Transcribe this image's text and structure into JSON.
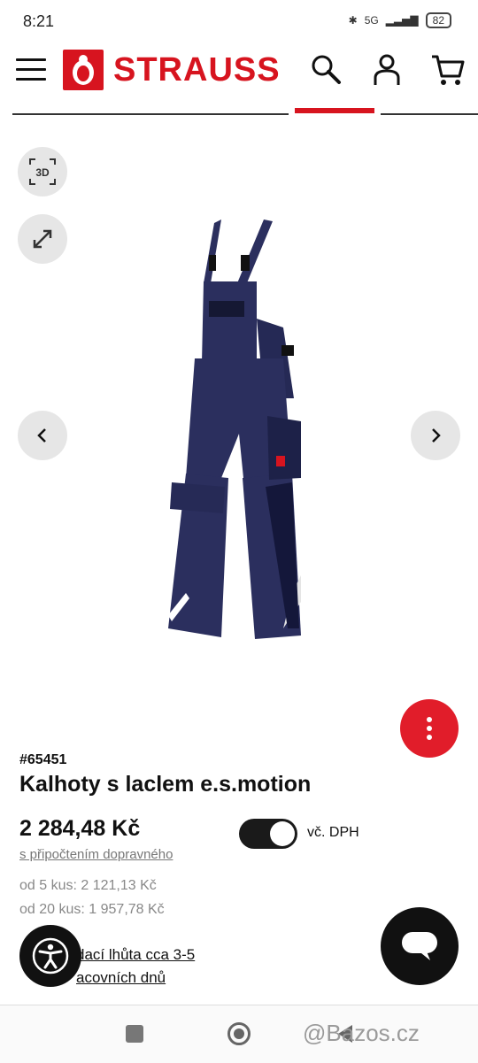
{
  "status": {
    "time": "8:21",
    "network": "5G",
    "battery": "82"
  },
  "header": {
    "brand": "STRAUSS"
  },
  "product": {
    "sku": "#65451",
    "title": "Kalhoty s laclem e.s.motion",
    "price": "2 284,48 Kč",
    "shipping_link": "s připočtením dopravného",
    "vat_toggle_label": "vč. DPH",
    "vat_toggle_on": true,
    "tiers": [
      {
        "label": "od 5 kus:",
        "price": "2 121,13 Kč"
      },
      {
        "label": "od 20 kus:",
        "price": "1 957,78 Kč"
      }
    ],
    "delivery_line1": "dací lhůta cca 3-5",
    "delivery_line2": "acovních dnů"
  },
  "watermark": "@Bazos.cz",
  "colors": {
    "brand_red": "#d7141f",
    "navy": "#2b2f5e"
  }
}
